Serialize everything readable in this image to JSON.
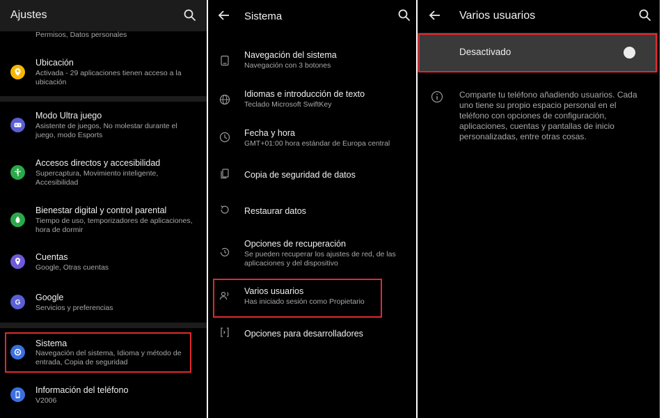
{
  "ajustes": {
    "title": "Ajustes",
    "top_partial_sub": "Permisos, Datos personales",
    "items": [
      {
        "title": "Ubicación",
        "sub": "Activada - 29 aplicaciones tienen acceso a la ubicación",
        "color": "#f5b800",
        "icon": "location-icon"
      },
      {
        "title": "Modo Ultra juego",
        "sub": "Asistente de juegos, No molestar durante el juego, modo Esports",
        "color": "#5a5fd6",
        "icon": "gamepad-icon"
      },
      {
        "title": "Accesos directos y accesibilidad",
        "sub": "Supercaptura, Movimiento inteligente, Accesibilidad",
        "color": "#2aa94a",
        "icon": "accessibility-icon"
      },
      {
        "title": "Bienestar digital y control parental",
        "sub": "Tiempo de uso, temporizadores de aplicaciones, hora de dormir",
        "color": "#2aa94a",
        "icon": "wellbeing-icon"
      },
      {
        "title": "Cuentas",
        "sub": "Google, Otras cuentas",
        "color": "#6e5ad8",
        "icon": "account-icon"
      },
      {
        "title": "Google",
        "sub": "Servicios y preferencias",
        "color": "#5a5fd6",
        "icon": "google-icon"
      },
      {
        "title": "Sistema",
        "sub": "Navegación del sistema, Idioma y método de entrada, Copia de seguridad",
        "color": "#3b6fe0",
        "icon": "system-gear-icon"
      },
      {
        "title": "Información del teléfono",
        "sub": "V2006",
        "color": "#3b6fe0",
        "icon": "phone-info-icon"
      }
    ]
  },
  "sistema": {
    "title": "Sistema",
    "items": [
      {
        "title": "Navegación del sistema",
        "sub": "Navegación con 3 botones",
        "icon": "navigation-icon"
      },
      {
        "title": "Idiomas e introducción de texto",
        "sub": "Teclado Microsoft SwiftKey",
        "icon": "globe-icon"
      },
      {
        "title": "Fecha y hora",
        "sub": "GMT+01:00 hora estándar de Europa central",
        "icon": "clock-icon"
      },
      {
        "title": "Copia de seguridad de datos",
        "sub": "",
        "icon": "backup-icon"
      },
      {
        "title": "Restaurar datos",
        "sub": "",
        "icon": "restore-icon"
      },
      {
        "title": "Opciones de recuperación",
        "sub": "Se pueden recuperar los ajustes de red, de las aplicaciones y del dispositivo",
        "icon": "history-icon"
      },
      {
        "title": "Varios usuarios",
        "sub": "Has iniciado sesión como Propietario",
        "icon": "users-icon"
      },
      {
        "title": "Opciones para desarrolladores",
        "sub": "",
        "icon": "developer-icon"
      }
    ]
  },
  "varios": {
    "title": "Varios usuarios",
    "toggle_label": "Desactivado",
    "toggle_on": false,
    "info": "Comparte tu teléfono añadiendo usuarios. Cada uno tiene su propio espacio personal en el teléfono con opciones de configuración, aplicaciones, cuentas y pantallas de inicio personalizadas, entre otras cosas."
  },
  "colors": {
    "highlight": "#e02a2f",
    "background": "#000000",
    "toggle_bar": "#3a3a3a"
  }
}
